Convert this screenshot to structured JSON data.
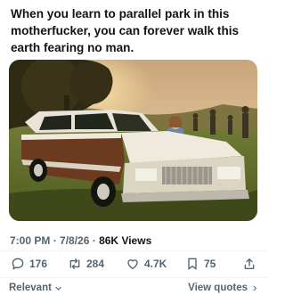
{
  "post": {
    "text": "When you learn to parallel park in this motherfucker, you can forever walk this earth fearing no man."
  },
  "meta": {
    "time": "7:00 PM",
    "separator": " · ",
    "date": "7/8/26",
    "views_count": "86K",
    "views_label": "Views"
  },
  "actions": {
    "replies": "176",
    "reposts": "284",
    "likes": "4.7K",
    "bookmarks": "75"
  },
  "footer": {
    "sort_label": "Relevant",
    "view_quotes_label": "View quotes"
  },
  "colors": {
    "text": "#0f1419",
    "muted": "#536471",
    "divider": "#eff3f4"
  },
  "icons": [
    "reply-icon",
    "repost-icon",
    "like-icon",
    "bookmark-icon",
    "share-icon",
    "chevron-down-icon",
    "chevron-right-icon"
  ]
}
